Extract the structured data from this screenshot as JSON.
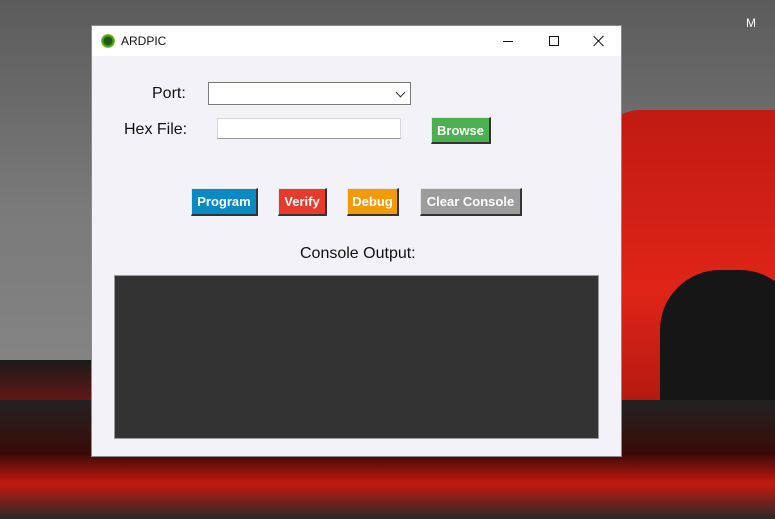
{
  "window": {
    "title": "ARDPIC"
  },
  "form": {
    "port_label": "Port:",
    "port_value": "",
    "hex_label": "Hex File:",
    "hex_value": "",
    "browse_label": "Browse"
  },
  "actions": {
    "program_label": "Program",
    "verify_label": "Verify",
    "debug_label": "Debug",
    "clear_label": "Clear Console"
  },
  "console": {
    "label": "Console Output:",
    "content": ""
  },
  "desktop": {
    "corner_text": "M"
  },
  "colors": {
    "browse": "#4caf50",
    "program": "#0a8ac2",
    "verify": "#e8392d",
    "debug": "#f29a0a",
    "clear": "#9c9c9c",
    "console_bg": "#333333"
  },
  "icons": {
    "app": "ardpic-chip-icon",
    "minimize": "minimize-icon",
    "maximize": "maximize-icon",
    "close": "close-icon",
    "dropdown": "chevron-down-icon"
  }
}
